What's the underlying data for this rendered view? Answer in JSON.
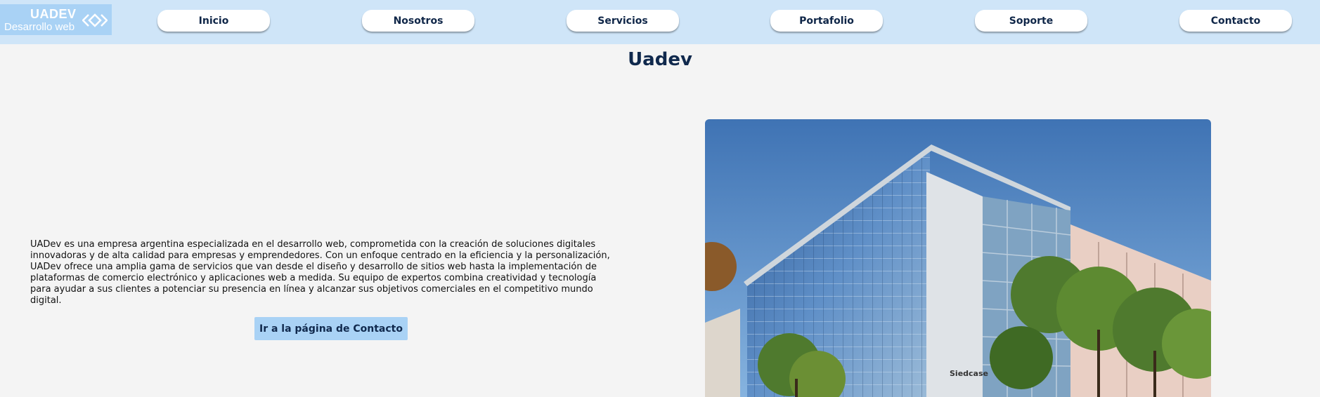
{
  "header": {
    "logo": {
      "title": "UADEV",
      "subtitle": "Desarrollo web"
    },
    "nav": [
      {
        "label": "Inicio"
      },
      {
        "label": "Nosotros"
      },
      {
        "label": "Servicios"
      },
      {
        "label": "Portafolio"
      },
      {
        "label": "Soporte"
      },
      {
        "label": "Contacto"
      }
    ]
  },
  "main": {
    "title": "Uadev",
    "description": "UADev es una empresa argentina especializada en el desarrollo web, comprometida con la creación de soluciones digitales innovadoras y de alta calidad para empresas y emprendedores. Con un enfoque centrado en la eficiencia y la personalización, UADev ofrece una amplia gama de servicios que van desde el diseño y desarrollo de sitios web hasta la implementación de plataformas de comercio electrónico y aplicaciones web a medida. Su equipo de expertos combina creatividad y tecnología para ayudar a sus clientes a potenciar su presencia en línea y alcanzar sus objetivos comerciales en el competitivo mundo digital.",
    "cta_label": "Ir a la página de Contacto",
    "image": {
      "subject": "modern glass office building",
      "building_sign": "Siedcase"
    }
  },
  "colors": {
    "navbar_bg": "#cfe5f8",
    "logo_bg": "#a9d2f5",
    "title_color": "#10294d",
    "cta_bg": "#a9d2f5",
    "page_bg": "#f4f4f4"
  }
}
